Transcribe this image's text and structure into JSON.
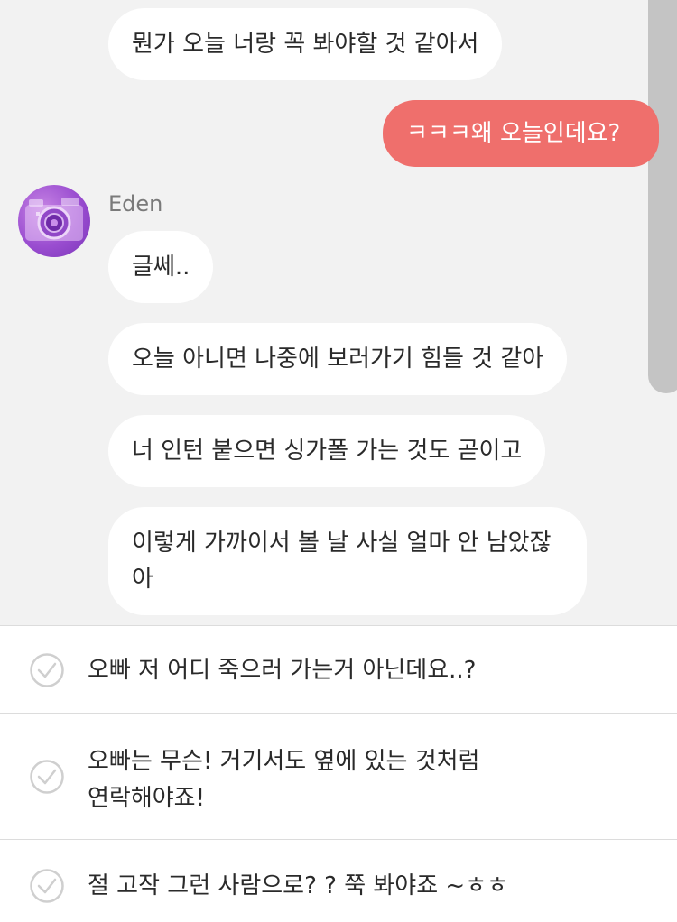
{
  "chat": {
    "messages": [
      {
        "from": "other",
        "text": "뭔가 오늘 너랑 꼭 봐야할 것 같아서"
      },
      {
        "from": "me",
        "text": "ㅋㅋㅋ왜 오늘인데요?"
      },
      {
        "from": "other",
        "text": "글쎄.."
      },
      {
        "from": "other",
        "text": "오늘 아니면 나중에 보러가기 힘들 것 같아"
      },
      {
        "from": "other",
        "text": "너 인턴 붙으면 싱가폴 가는 것도 곧이고"
      },
      {
        "from": "other",
        "lines": [
          "이렇게 가까이서 볼 날 사실 얼마 안 남았잖",
          "아"
        ]
      }
    ],
    "sender_name": "Eden",
    "avatar_icon": "camera-avatar-icon"
  },
  "choices": [
    {
      "lines": [
        "오빠 저 어디 죽으러 가는거 아닌데요..?"
      ]
    },
    {
      "lines": [
        "오빠는 무슨! 거기서도 옆에 있는 것처럼",
        "연락해야죠!"
      ]
    },
    {
      "lines": [
        "절 고작 그런 사람으로? ? 쭉 봐야죠 ~ㅎㅎ"
      ]
    }
  ],
  "colors": {
    "chat_background": "#f2f2f2",
    "my_bubble": "#ef6f6c",
    "other_bubble": "#ffffff",
    "scrollbar": "#c4c4c4",
    "check_icon": "#cfcfcf"
  }
}
